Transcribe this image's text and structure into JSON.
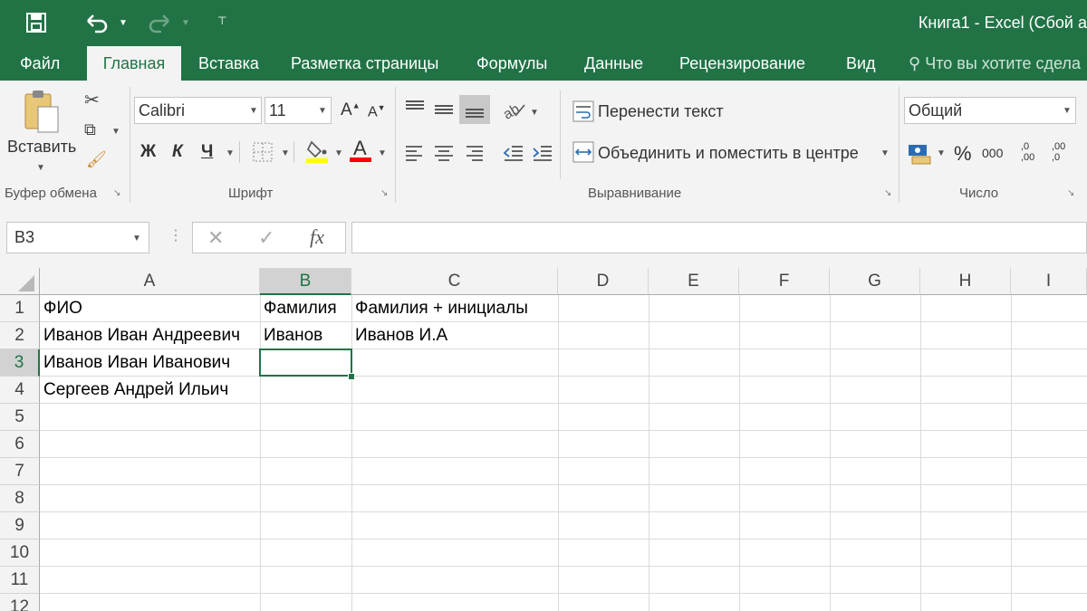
{
  "window": {
    "title": "Книга1 - Excel (Сбой а"
  },
  "quick_access": {
    "save_icon": "save-icon",
    "undo_icon": "undo-icon",
    "redo_icon": "redo-icon",
    "customize_icon": "customize-icon"
  },
  "tabs": [
    {
      "label": "Файл"
    },
    {
      "label": "Главная",
      "active": true
    },
    {
      "label": "Вставка"
    },
    {
      "label": "Разметка страницы"
    },
    {
      "label": "Формулы"
    },
    {
      "label": "Данные"
    },
    {
      "label": "Рецензирование"
    },
    {
      "label": "Вид"
    },
    {
      "label": "Что вы хотите сдела"
    }
  ],
  "ribbon": {
    "clipboard": {
      "paste_label": "Вставить",
      "group_label": "Буфер обмена"
    },
    "font": {
      "name": "Calibri",
      "size": "11",
      "bold": "Ж",
      "italic": "К",
      "underline": "Ч",
      "group_label": "Шрифт",
      "highlight_color": "#FFFF00",
      "font_color": "#FF0000"
    },
    "alignment": {
      "wrap_text": "Перенести текст",
      "merge_center": "Объединить и поместить в центре",
      "group_label": "Выравнивание"
    },
    "number": {
      "format": "Общий",
      "percent": "%",
      "thousands": "000",
      "inc_decimal": ",0 ,00",
      "dec_decimal": ",00 ,0",
      "group_label": "Число"
    }
  },
  "formula_bar": {
    "name_box": "B3",
    "cancel": "✕",
    "enter": "✓",
    "fx": "fx",
    "value": ""
  },
  "sheet": {
    "columns": [
      "A",
      "B",
      "C",
      "D",
      "E",
      "F",
      "G",
      "H",
      "I"
    ],
    "rows": [
      "1",
      "2",
      "3",
      "4",
      "5",
      "6",
      "7",
      "8",
      "9",
      "10",
      "11",
      "12"
    ],
    "cells": {
      "A1": "ФИО",
      "B1": "Фамилия",
      "C1": "Фамилия + инициалы",
      "A2": "Иванов Иван Андреевич",
      "B2": "Иванов",
      "C2": "Иванов И.А",
      "A3": "Иванов Иван Иванович",
      "A4": "Сергеев Андрей Ильич"
    },
    "selected_cell": "B3"
  },
  "colors": {
    "accent": "#217346",
    "ribbon_bg": "#F3F3F3"
  }
}
